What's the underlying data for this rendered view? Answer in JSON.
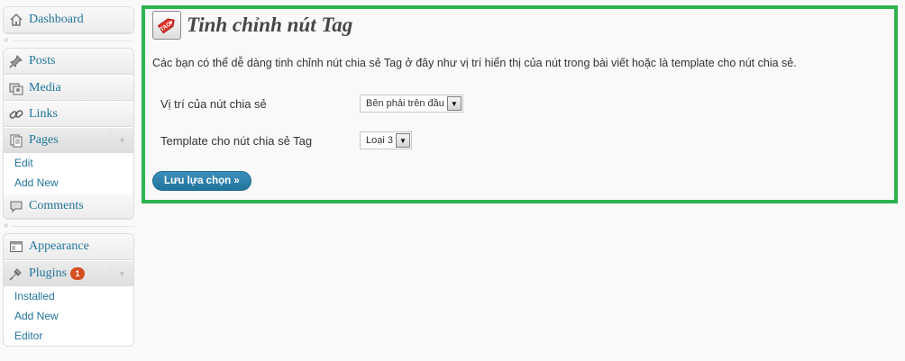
{
  "sidebar": {
    "group1": [
      {
        "label": "Dashboard",
        "icon": "dashboard-icon"
      }
    ],
    "group2": [
      {
        "label": "Posts",
        "icon": "pin-icon"
      },
      {
        "label": "Media",
        "icon": "media-icon"
      },
      {
        "label": "Links",
        "icon": "link-icon"
      },
      {
        "label": "Pages",
        "icon": "pages-icon",
        "submenu": [
          "Edit",
          "Add New"
        ]
      },
      {
        "label": "Comments",
        "icon": "comment-icon"
      }
    ],
    "group3": [
      {
        "label": "Appearance",
        "icon": "appearance-icon"
      },
      {
        "label": "Plugins",
        "icon": "plugin-icon",
        "badge": "1",
        "submenu": [
          "Installed",
          "Add New",
          "Editor"
        ]
      }
    ],
    "separator_arrow": "«"
  },
  "main": {
    "title": "Tinh chỉnh nút Tag",
    "logo_text": "TAG",
    "intro": "Các bạn có thể dễ dàng tinh chỉnh nút chia sẻ Tag ở đây như vị trí hiển thị của nút trong bài viết hoặc là template cho nút chia sẻ.",
    "options": [
      {
        "label": "Vị trí của nút chia sẻ",
        "value": "Bên phải trên đầu"
      },
      {
        "label": "Template cho nút chia sẻ Tag",
        "value": "Loại 3"
      }
    ],
    "save_label": "Lưu lựa chọn »"
  },
  "colors": {
    "accent": "#21759b",
    "panel_border": "#2db24f",
    "badge": "#d54e21"
  }
}
